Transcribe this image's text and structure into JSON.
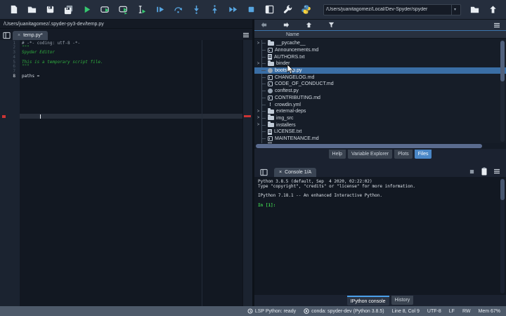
{
  "toolbar": {
    "icons": [
      "new-file",
      "open-file",
      "save",
      "save-all",
      "run",
      "run-cell",
      "run-cell-advance",
      "run-selection",
      "debug-file",
      "step-over",
      "step-into",
      "step-return",
      "continue-execution",
      "stop",
      "maximize-pane",
      "preferences",
      "python-logo",
      "browse-working-directory",
      "parent-directory"
    ],
    "working_dir": "/Users/juanitagomez/Local/Dev-Spyder/spyder"
  },
  "editor": {
    "breadcrumb": "/Users/juanitagomez/.spyder-py3-dev/temp.py",
    "tab_label": "temp.py*",
    "close_glyph": "×",
    "lines": [
      {
        "num": "1",
        "text": "# -*- coding: utf-8 -*-"
      },
      {
        "num": "2",
        "text": "\"\"\""
      },
      {
        "num": "3",
        "text": "Spyder Editor"
      },
      {
        "num": "4",
        "text": ""
      },
      {
        "num": "5",
        "text": "This is a temporary script file."
      },
      {
        "num": "6",
        "text": ""
      },
      {
        "num": "7",
        "text": ""
      },
      {
        "num": "8",
        "text": "paths ="
      }
    ],
    "line6_text": "\"\"\""
  },
  "files": {
    "column_header": "Name",
    "chevron_glyph": ">",
    "items": [
      {
        "name": "__pycache__",
        "kind": "folder"
      },
      {
        "name": "Announcements.md",
        "kind": "md"
      },
      {
        "name": "AUTHORS.txt",
        "kind": "txt"
      },
      {
        "name": "binder",
        "kind": "folder"
      },
      {
        "name": "bootstrap.py",
        "kind": "py",
        "selected": true
      },
      {
        "name": "CHANGELOG.md",
        "kind": "md"
      },
      {
        "name": "CODE_OF_CONDUCT.md",
        "kind": "md"
      },
      {
        "name": "conftest.py",
        "kind": "py"
      },
      {
        "name": "CONTRIBUTING.md",
        "kind": "md"
      },
      {
        "name": "crowdin.yml",
        "kind": "yml",
        "glyph": "!"
      },
      {
        "name": "external-deps",
        "kind": "folder"
      },
      {
        "name": "img_src",
        "kind": "folder"
      },
      {
        "name": "installers",
        "kind": "folder"
      },
      {
        "name": "LICENSE.txt",
        "kind": "txt"
      },
      {
        "name": "MAINTENANCE.md",
        "kind": "md"
      },
      {
        "name": "MANIFEST.in",
        "kind": "txt"
      }
    ],
    "tabs": {
      "help": "Help",
      "variable_explorer": "Variable Explorer",
      "plots": "Plots",
      "files": "Files"
    },
    "active_tab": "Files"
  },
  "console": {
    "tab_label": "Console 1/A",
    "close_glyph": "×",
    "banner": [
      "Python 3.8.5 (default, Sep  4 2020, 02:22:02)",
      "Type \"copyright\", \"credits\" or \"license\" for more information.",
      "",
      "IPython 7.18.1 -- An enhanced Interactive Python.",
      ""
    ],
    "prompt": "In [1]:",
    "tabs": {
      "ipython": "IPython console",
      "history": "History"
    },
    "active_tab": "IPython console"
  },
  "statusbar": {
    "lsp": "LSP Python: ready",
    "env": "conda: spyder-dev (Python 3.8.5)",
    "cursor_pos": "Line 8, Col 9",
    "encoding": "UTF-8",
    "eol": "LF",
    "permissions": "RW",
    "memory": "Mem 67%"
  },
  "colors": {
    "accent_blue": "#4a87c7",
    "selection_blue": "#3a6ea5",
    "run_green": "#37c871",
    "debug_blue": "#57a5e0",
    "error_red": "#cc3434",
    "editor_bg": "#121822",
    "toolbar_bg": "#252e3d",
    "statusbar_bg": "#4e5a6a",
    "string_green": "#2fae3e"
  }
}
